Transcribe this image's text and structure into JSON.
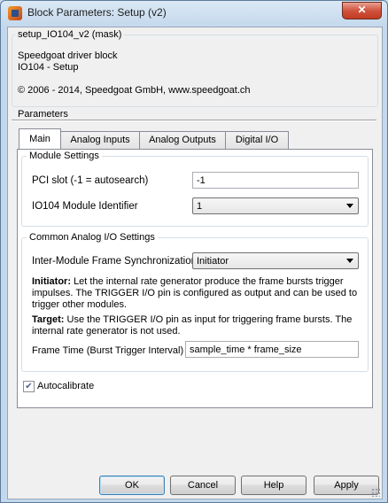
{
  "window": {
    "title": "Block Parameters: Setup (v2)",
    "close_glyph": "✕"
  },
  "header": {
    "mask_title": "setup_IO104_v2 (mask)",
    "description_line1": "Speedgoat driver block",
    "description_line2": "IO104 - Setup",
    "copyright": "© 2006 - 2014, Speedgoat GmbH, www.speedgoat.ch"
  },
  "parameters_label": "Parameters",
  "tabs": [
    {
      "label": "Main",
      "active": true
    },
    {
      "label": "Analog Inputs",
      "active": false
    },
    {
      "label": "Analog Outputs",
      "active": false
    },
    {
      "label": "Digital I/O",
      "active": false
    }
  ],
  "module_settings": {
    "label": "Module Settings",
    "pci_slot_label": "PCI slot (-1 = autosearch)",
    "pci_slot_value": "-1",
    "module_id_label": "IO104 Module Identifier",
    "module_id_value": "1"
  },
  "analog_io": {
    "label": "Common Analog I/O Settings",
    "sync_label": "Inter-Module Frame Synchronization",
    "sync_value": "Initiator",
    "initiator_title": "Initiator:",
    "initiator_text": "Let the internal rate generator produce the frame bursts trigger impulses. The TRIGGER I/O pin is configured as output and can be used to trigger other modules.",
    "target_title": "Target:",
    "target_text": "Use the TRIGGER I/O pin as input for triggering frame bursts. The internal rate generator is not used.",
    "frame_time_label": "Frame Time (Burst Trigger Interval)",
    "frame_time_value": "sample_time * frame_size"
  },
  "autocalibrate": {
    "label": "Autocalibrate",
    "checked": true,
    "check_glyph": "✔"
  },
  "buttons": {
    "ok": "OK",
    "cancel": "Cancel",
    "help": "Help",
    "apply": "Apply"
  },
  "colors": {
    "titlebar": "#c3d8ec",
    "close_button": "#c23a22",
    "client_bg": "#f0f0f0",
    "panel_bg": "#ffffff"
  }
}
